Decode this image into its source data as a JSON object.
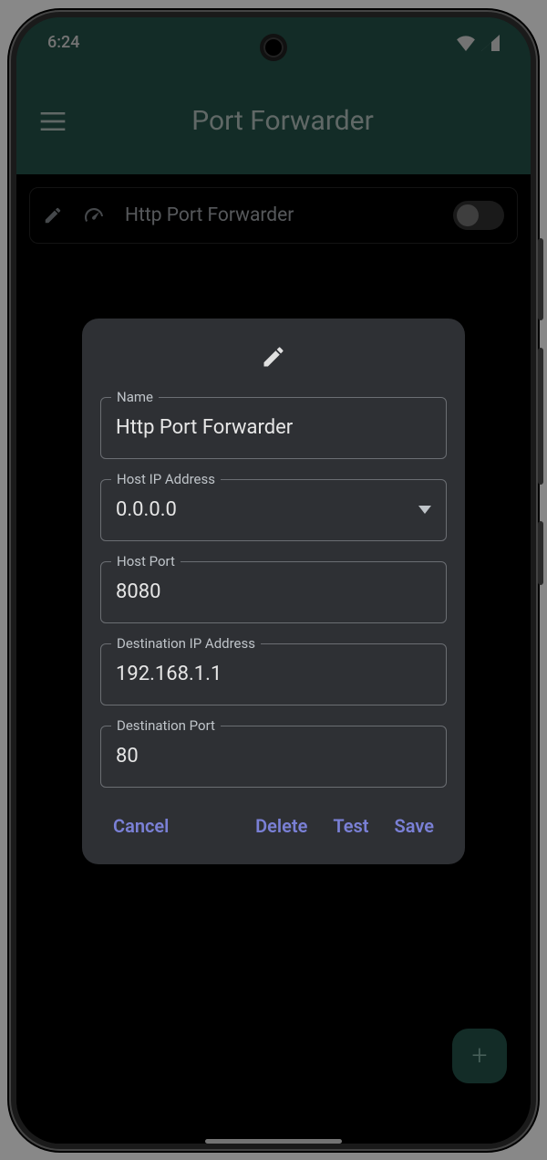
{
  "status": {
    "time": "6:24"
  },
  "header": {
    "title": "Port Forwarder"
  },
  "rule": {
    "label": "Http Port Forwarder",
    "enabled": false
  },
  "dialog": {
    "fields": {
      "name": {
        "label": "Name",
        "value": "Http Port Forwarder"
      },
      "host_ip": {
        "label": "Host IP Address",
        "value": "0.0.0.0"
      },
      "host_port": {
        "label": "Host Port",
        "value": "8080"
      },
      "dest_ip": {
        "label": "Destination IP Address",
        "value": "192.168.1.1"
      },
      "dest_port": {
        "label": "Destination Port",
        "value": "80"
      }
    },
    "actions": {
      "cancel": "Cancel",
      "delete": "Delete",
      "test": "Test",
      "save": "Save"
    }
  },
  "fab": {
    "label": "+"
  }
}
